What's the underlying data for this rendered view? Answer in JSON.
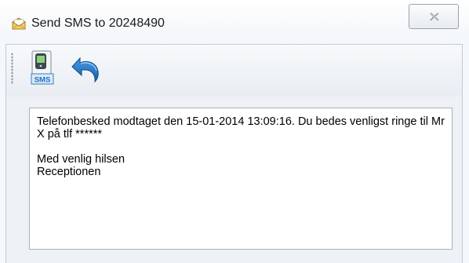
{
  "window": {
    "title": "Send SMS to 20248490",
    "title_icon": "envelope-icon"
  },
  "titlebar": {
    "close_icon": "close-icon"
  },
  "toolbar": {
    "items": [
      {
        "icon": "sms-phone-icon",
        "label": "SMS"
      },
      {
        "icon": "undo-arrow-icon"
      }
    ]
  },
  "message": {
    "text": "Telefonbesked modtaget den 15-01-2014 13:09:16. Du bedes venligst ringe til Mr X på tlf ******\n\nMed venlig hilsen\nReceptionen"
  },
  "colors": {
    "accent": "#1f6fc5",
    "window_bg": "#f4f7fb",
    "border": "#a7b2bd"
  }
}
